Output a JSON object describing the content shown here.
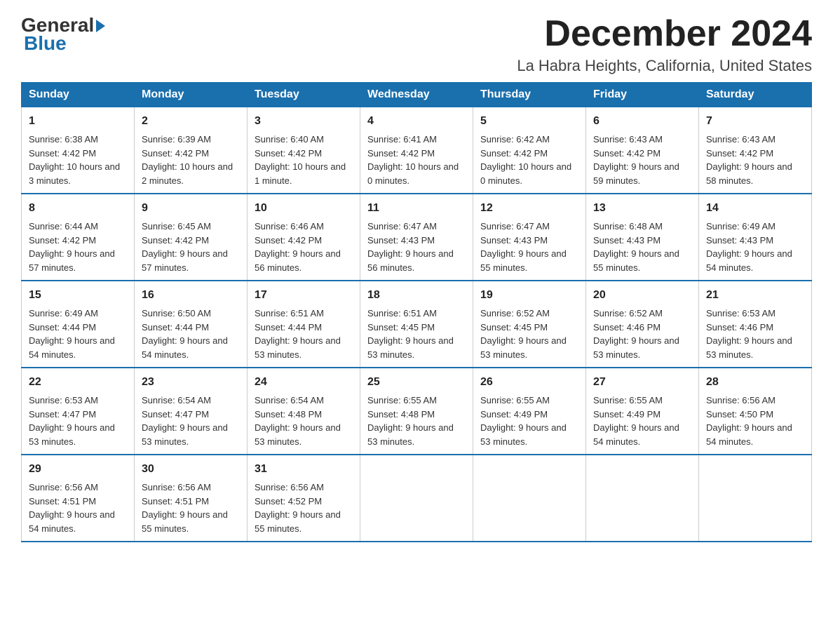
{
  "logo": {
    "general": "General",
    "blue": "Blue"
  },
  "header": {
    "month": "December 2024",
    "location": "La Habra Heights, California, United States"
  },
  "weekdays": [
    "Sunday",
    "Monday",
    "Tuesday",
    "Wednesday",
    "Thursday",
    "Friday",
    "Saturday"
  ],
  "weeks": [
    [
      {
        "day": "1",
        "sunrise": "6:38 AM",
        "sunset": "4:42 PM",
        "daylight": "10 hours and 3 minutes."
      },
      {
        "day": "2",
        "sunrise": "6:39 AM",
        "sunset": "4:42 PM",
        "daylight": "10 hours and 2 minutes."
      },
      {
        "day": "3",
        "sunrise": "6:40 AM",
        "sunset": "4:42 PM",
        "daylight": "10 hours and 1 minute."
      },
      {
        "day": "4",
        "sunrise": "6:41 AM",
        "sunset": "4:42 PM",
        "daylight": "10 hours and 0 minutes."
      },
      {
        "day": "5",
        "sunrise": "6:42 AM",
        "sunset": "4:42 PM",
        "daylight": "10 hours and 0 minutes."
      },
      {
        "day": "6",
        "sunrise": "6:43 AM",
        "sunset": "4:42 PM",
        "daylight": "9 hours and 59 minutes."
      },
      {
        "day": "7",
        "sunrise": "6:43 AM",
        "sunset": "4:42 PM",
        "daylight": "9 hours and 58 minutes."
      }
    ],
    [
      {
        "day": "8",
        "sunrise": "6:44 AM",
        "sunset": "4:42 PM",
        "daylight": "9 hours and 57 minutes."
      },
      {
        "day": "9",
        "sunrise": "6:45 AM",
        "sunset": "4:42 PM",
        "daylight": "9 hours and 57 minutes."
      },
      {
        "day": "10",
        "sunrise": "6:46 AM",
        "sunset": "4:42 PM",
        "daylight": "9 hours and 56 minutes."
      },
      {
        "day": "11",
        "sunrise": "6:47 AM",
        "sunset": "4:43 PM",
        "daylight": "9 hours and 56 minutes."
      },
      {
        "day": "12",
        "sunrise": "6:47 AM",
        "sunset": "4:43 PM",
        "daylight": "9 hours and 55 minutes."
      },
      {
        "day": "13",
        "sunrise": "6:48 AM",
        "sunset": "4:43 PM",
        "daylight": "9 hours and 55 minutes."
      },
      {
        "day": "14",
        "sunrise": "6:49 AM",
        "sunset": "4:43 PM",
        "daylight": "9 hours and 54 minutes."
      }
    ],
    [
      {
        "day": "15",
        "sunrise": "6:49 AM",
        "sunset": "4:44 PM",
        "daylight": "9 hours and 54 minutes."
      },
      {
        "day": "16",
        "sunrise": "6:50 AM",
        "sunset": "4:44 PM",
        "daylight": "9 hours and 54 minutes."
      },
      {
        "day": "17",
        "sunrise": "6:51 AM",
        "sunset": "4:44 PM",
        "daylight": "9 hours and 53 minutes."
      },
      {
        "day": "18",
        "sunrise": "6:51 AM",
        "sunset": "4:45 PM",
        "daylight": "9 hours and 53 minutes."
      },
      {
        "day": "19",
        "sunrise": "6:52 AM",
        "sunset": "4:45 PM",
        "daylight": "9 hours and 53 minutes."
      },
      {
        "day": "20",
        "sunrise": "6:52 AM",
        "sunset": "4:46 PM",
        "daylight": "9 hours and 53 minutes."
      },
      {
        "day": "21",
        "sunrise": "6:53 AM",
        "sunset": "4:46 PM",
        "daylight": "9 hours and 53 minutes."
      }
    ],
    [
      {
        "day": "22",
        "sunrise": "6:53 AM",
        "sunset": "4:47 PM",
        "daylight": "9 hours and 53 minutes."
      },
      {
        "day": "23",
        "sunrise": "6:54 AM",
        "sunset": "4:47 PM",
        "daylight": "9 hours and 53 minutes."
      },
      {
        "day": "24",
        "sunrise": "6:54 AM",
        "sunset": "4:48 PM",
        "daylight": "9 hours and 53 minutes."
      },
      {
        "day": "25",
        "sunrise": "6:55 AM",
        "sunset": "4:48 PM",
        "daylight": "9 hours and 53 minutes."
      },
      {
        "day": "26",
        "sunrise": "6:55 AM",
        "sunset": "4:49 PM",
        "daylight": "9 hours and 53 minutes."
      },
      {
        "day": "27",
        "sunrise": "6:55 AM",
        "sunset": "4:49 PM",
        "daylight": "9 hours and 54 minutes."
      },
      {
        "day": "28",
        "sunrise": "6:56 AM",
        "sunset": "4:50 PM",
        "daylight": "9 hours and 54 minutes."
      }
    ],
    [
      {
        "day": "29",
        "sunrise": "6:56 AM",
        "sunset": "4:51 PM",
        "daylight": "9 hours and 54 minutes."
      },
      {
        "day": "30",
        "sunrise": "6:56 AM",
        "sunset": "4:51 PM",
        "daylight": "9 hours and 55 minutes."
      },
      {
        "day": "31",
        "sunrise": "6:56 AM",
        "sunset": "4:52 PM",
        "daylight": "9 hours and 55 minutes."
      },
      null,
      null,
      null,
      null
    ]
  ],
  "labels": {
    "sunrise": "Sunrise:",
    "sunset": "Sunset:",
    "daylight": "Daylight:"
  }
}
